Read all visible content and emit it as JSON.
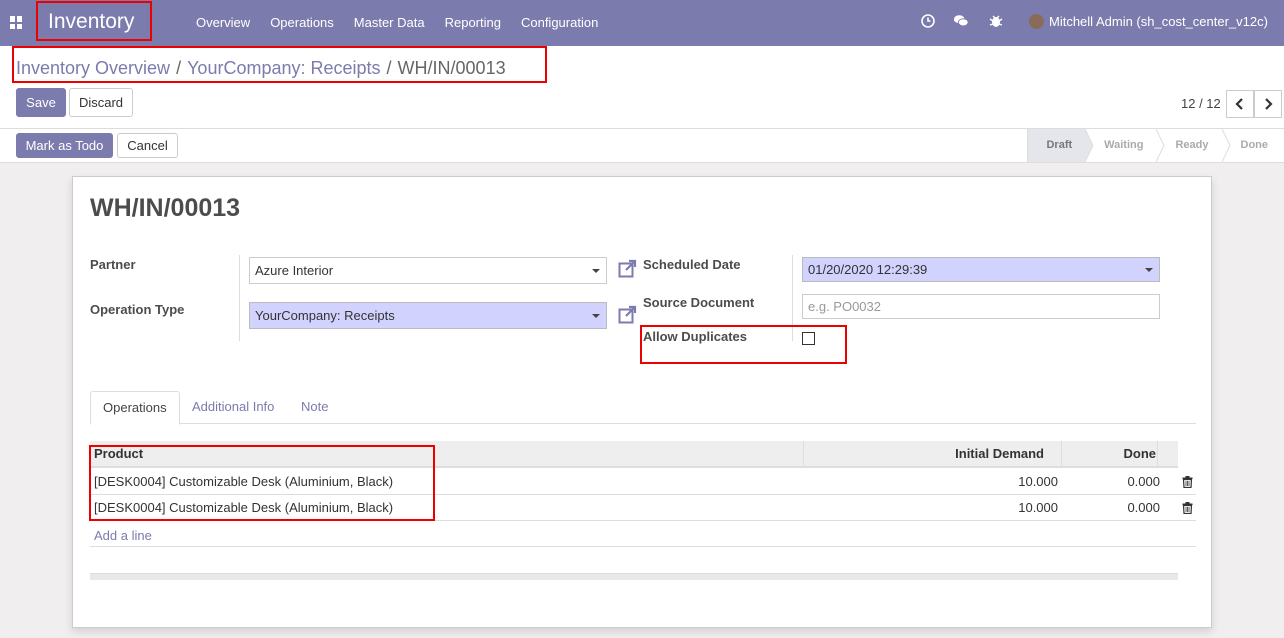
{
  "navbar": {
    "brand": "Inventory",
    "menu": [
      "Overview",
      "Operations",
      "Master Data",
      "Reporting",
      "Configuration"
    ],
    "user": "Mitchell Admin (sh_cost_center_v12c)"
  },
  "breadcrumb": {
    "items": [
      "Inventory Overview",
      "YourCompany: Receipts"
    ],
    "current": "WH/IN/00013"
  },
  "buttons": {
    "save": "Save",
    "discard": "Discard",
    "mark_todo": "Mark as Todo",
    "cancel": "Cancel"
  },
  "pager": {
    "value": "12 / 12"
  },
  "status": {
    "steps": [
      "Draft",
      "Waiting",
      "Ready",
      "Done"
    ],
    "active": "Draft"
  },
  "record": {
    "name": "WH/IN/00013",
    "partner_label": "Partner",
    "partner": "Azure Interior",
    "operation_type_label": "Operation Type",
    "operation_type": "YourCompany: Receipts",
    "scheduled_date_label": "Scheduled Date",
    "scheduled_date": "01/20/2020 12:29:39",
    "source_document_label": "Source Document",
    "source_document_placeholder": "e.g. PO0032",
    "allow_duplicates_label": "Allow Duplicates",
    "allow_duplicates": false
  },
  "tabs": [
    "Operations",
    "Additional Info",
    "Note"
  ],
  "table": {
    "headers": {
      "product": "Product",
      "initial_demand": "Initial Demand",
      "done": "Done"
    },
    "rows": [
      {
        "product": "[DESK0004] Customizable Desk (Aluminium, Black)",
        "initial_demand": "10.000",
        "done": "0.000"
      },
      {
        "product": "[DESK0004] Customizable Desk (Aluminium, Black)",
        "initial_demand": "10.000",
        "done": "0.000"
      }
    ],
    "add_line": "Add a line"
  },
  "colors": {
    "brand": "#7c7bad",
    "required_field": "#d2d2ff",
    "highlight": "#ee0000"
  }
}
